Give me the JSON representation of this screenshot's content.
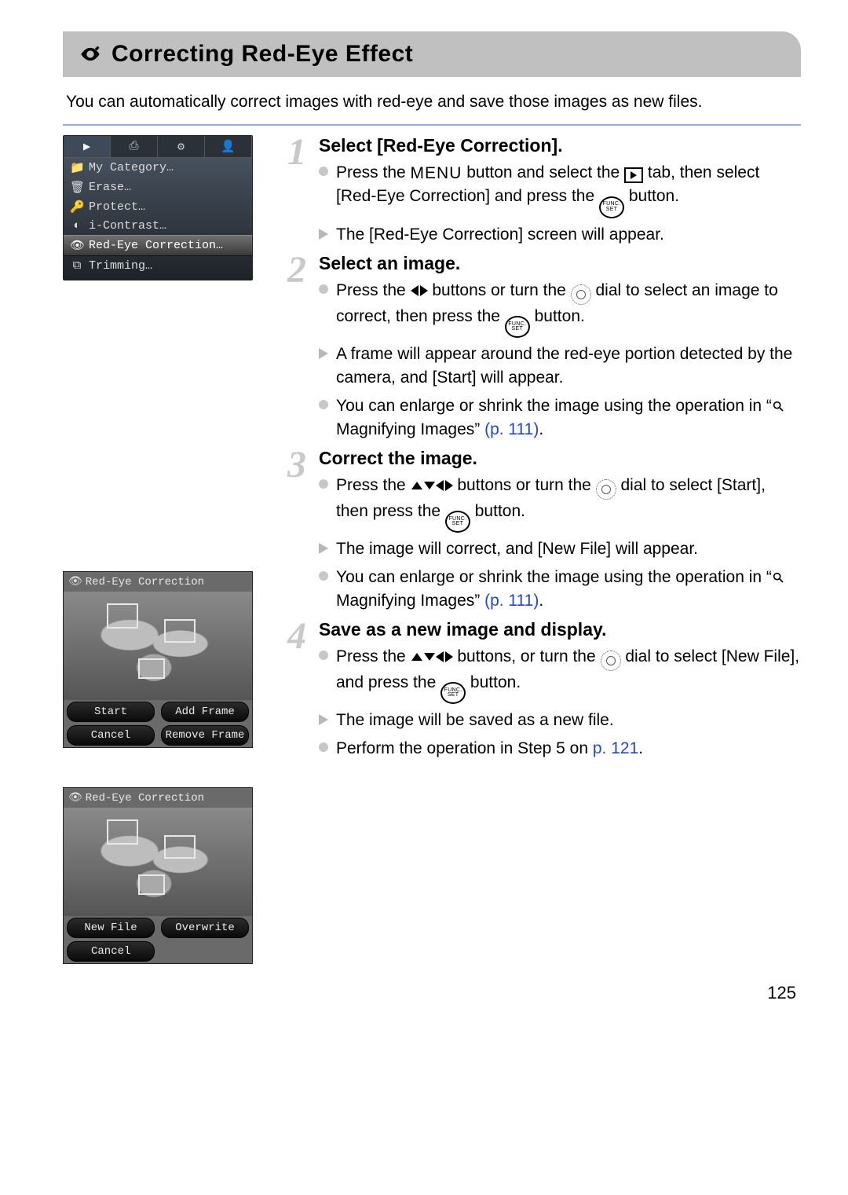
{
  "header": {
    "icon": "red-eye-icon",
    "title": "Correcting Red-Eye Effect"
  },
  "intro": "You can automatically correct images with red-eye and save those images as new files.",
  "camera_menu": {
    "tabs": [
      "▶",
      "⎙",
      "⚙",
      "👤"
    ],
    "items": [
      {
        "icon": "📁",
        "label": "My Category…"
      },
      {
        "icon": "🗑",
        "label": "Erase…"
      },
      {
        "icon": "🔑",
        "label": "Protect…"
      },
      {
        "icon": "◐",
        "label": "i-Contrast…"
      },
      {
        "icon": "👁",
        "label": "Red-Eye Correction…",
        "selected": true
      },
      {
        "icon": "⧉",
        "label": "Trimming…"
      }
    ]
  },
  "preview2": {
    "title": "Red-Eye Correction",
    "buttons": [
      "Start",
      "Add Frame",
      "Cancel",
      "Remove Frame"
    ]
  },
  "preview3": {
    "title": "Red-Eye Correction",
    "buttons_row1": [
      "New File",
      "Overwrite"
    ],
    "buttons_row2": [
      "Cancel"
    ]
  },
  "steps": [
    {
      "num": "1",
      "heading": "Select [Red-Eye Correction].",
      "items": [
        {
          "type": "circle",
          "parts": [
            "Press the ",
            {
              "glyph": "MENU"
            },
            " button and select the ",
            {
              "glyph": "play"
            },
            " tab, then select [Red-Eye Correction] and press the ",
            {
              "glyph": "func"
            },
            " button."
          ]
        },
        {
          "type": "tri",
          "parts": [
            "The [Red-Eye Correction] screen will appear."
          ]
        }
      ]
    },
    {
      "num": "2",
      "heading": "Select an image.",
      "items": [
        {
          "type": "circle",
          "parts": [
            "Press the ",
            {
              "glyph": "lr"
            },
            " buttons or turn the ",
            {
              "glyph": "dial"
            },
            " dial to select an image to correct, then press the ",
            {
              "glyph": "func"
            },
            " button."
          ]
        },
        {
          "type": "tri",
          "parts": [
            "A frame will appear around the red-eye portion detected by the camera, and [Start] will appear."
          ]
        },
        {
          "type": "circle",
          "parts": [
            "You can enlarge or shrink the image using the operation in “",
            {
              "glyph": "mag"
            },
            " Magnifying Images” ",
            {
              "link": "(p. 111)"
            },
            "."
          ]
        }
      ]
    },
    {
      "num": "3",
      "heading": "Correct the image.",
      "items": [
        {
          "type": "circle",
          "parts": [
            "Press the ",
            {
              "glyph": "udlr"
            },
            " buttons or turn the ",
            {
              "glyph": "dial"
            },
            " dial to select [Start], then press the ",
            {
              "glyph": "func"
            },
            " button."
          ]
        },
        {
          "type": "tri",
          "parts": [
            "The image will correct, and [New File] will appear."
          ]
        },
        {
          "type": "circle",
          "parts": [
            "You can enlarge or shrink the image using the operation in “",
            {
              "glyph": "mag"
            },
            " Magnifying Images” ",
            {
              "link": "(p. 111)"
            },
            "."
          ]
        }
      ]
    },
    {
      "num": "4",
      "heading": "Save as a new image and display.",
      "items": [
        {
          "type": "circle",
          "parts": [
            "Press the ",
            {
              "glyph": "udlr"
            },
            " buttons, or turn the ",
            {
              "glyph": "dial"
            },
            " dial to select [New File], and press the ",
            {
              "glyph": "func"
            },
            " button."
          ]
        },
        {
          "type": "tri",
          "parts": [
            "The image will be saved as a new file."
          ]
        },
        {
          "type": "circle",
          "parts": [
            "Perform the operation in Step 5 on ",
            {
              "link": "p. 121"
            },
            "."
          ]
        }
      ]
    }
  ],
  "page_number": "125"
}
